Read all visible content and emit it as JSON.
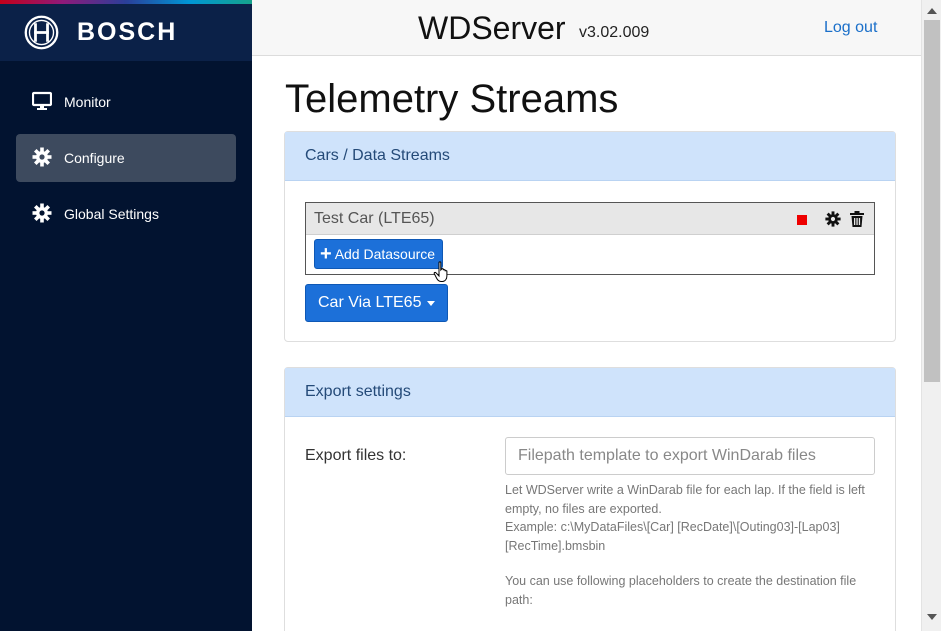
{
  "brand": {
    "name": "BOSCH"
  },
  "sidebar": {
    "items": [
      {
        "label": "Monitor",
        "icon": "monitor-icon",
        "active": false
      },
      {
        "label": "Configure",
        "icon": "gear-icon",
        "active": true
      },
      {
        "label": "Global Settings",
        "icon": "gear-icon",
        "active": false
      }
    ]
  },
  "header": {
    "title": "WDServer",
    "version": "v3.02.009",
    "logout": "Log out"
  },
  "page": {
    "title": "Telemetry Streams"
  },
  "streams": {
    "header": "Cars / Data Streams",
    "car": {
      "name": "Test Car (LTE65)",
      "status_color": "#ee0000",
      "icons": [
        "stop-icon",
        "gear-icon",
        "trash-icon"
      ]
    },
    "add_button": "Add Datasource",
    "dropdown": "Car Via LTE65"
  },
  "export": {
    "header": "Export settings",
    "label": "Export files to:",
    "input_value": "",
    "input_placeholder": "Filepath template to export WinDarab files",
    "help1": "Let WDServer write a WinDarab file for each lap. If the field is left empty, no files are exported.",
    "help2": "Example: c:\\MyDataFiles\\[Car] [RecDate]\\[Outing03]-[Lap03] [RecTime].bmsbin",
    "help3": "You can use following placeholders to create the destination file path:"
  },
  "colors": {
    "sidebar": "#021330",
    "accent": "#1c70d9",
    "card_header": "#cfe3fb"
  }
}
